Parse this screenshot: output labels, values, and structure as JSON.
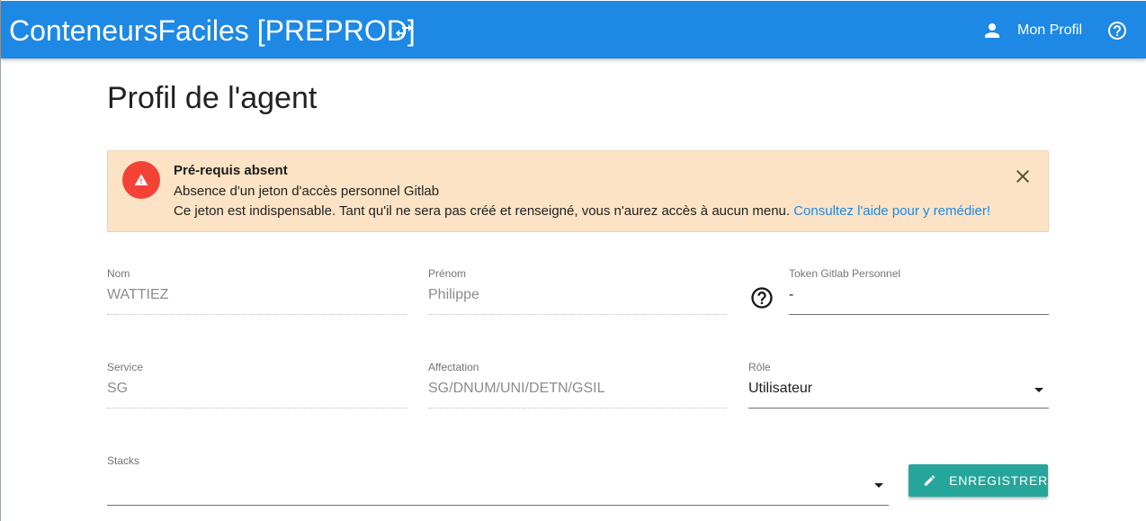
{
  "appbar": {
    "title": "ConteneursFaciles [PREPROD]",
    "swap_icon": "swap-horiz-icon",
    "profile_label": "Mon Profil",
    "profile_icon": "person-icon",
    "help_icon": "help-circle-outline-icon",
    "color": "#1e88e5"
  },
  "page": {
    "title": "Profil de l'agent"
  },
  "alert": {
    "title": "Pré-requis absent",
    "line1": "Absence d'un jeton d'accès personnel Gitlab",
    "line2": "Ce jeton est indispensable. Tant qu'il ne sera pas créé et renseigné, vous n'aurez accès à aucun menu.",
    "link": "Consultez l'aide pour y remédier!",
    "icon": "warning-icon",
    "close_icon": "close-icon",
    "background": "#fde3c5",
    "badge_color": "#f44336"
  },
  "form": {
    "nom": {
      "label": "Nom",
      "value": "WATTIEZ"
    },
    "prenom": {
      "label": "Prénom",
      "value": "Philippe"
    },
    "token": {
      "label": "Token Gitlab Personnel",
      "value": "-",
      "help_icon": "help-circle-outline-icon"
    },
    "service": {
      "label": "Service",
      "value": "SG"
    },
    "affectation": {
      "label": "Affectation",
      "value": "SG/DNUM/UNI/DETN/GSIL"
    },
    "role": {
      "label": "Rôle",
      "value": "Utilisateur"
    },
    "stacks": {
      "label": "Stacks",
      "value": ""
    }
  },
  "save_button": {
    "label": "ENREGISTRER",
    "icon": "pencil-icon",
    "color": "#26a69a"
  }
}
